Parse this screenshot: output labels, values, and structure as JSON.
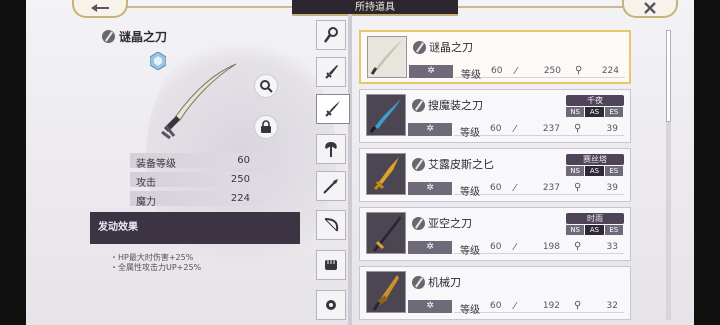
{
  "header": {
    "title": "所持道具",
    "back_icon": "back-arrow-icon",
    "close_icon": "close-x-icon"
  },
  "detail": {
    "name": "谜晶之刀",
    "stats": [
      {
        "label": "装备等级",
        "value": "60"
      },
      {
        "label": "攻击",
        "value": "250"
      },
      {
        "label": "魔力",
        "value": "224"
      }
    ],
    "effect_header": "发动效果",
    "effects": [
      "・HP最大时伤害+25%",
      "・全属性攻击力UP+25%"
    ]
  },
  "tabs": [
    {
      "icon": "staff-icon"
    },
    {
      "icon": "dagger-icon"
    },
    {
      "icon": "sword-icon",
      "active": true
    },
    {
      "icon": "axe-icon"
    },
    {
      "icon": "spear-icon"
    },
    {
      "icon": "bow-icon"
    },
    {
      "icon": "fist-icon"
    },
    {
      "icon": "gear-weapon-icon"
    }
  ],
  "items": [
    {
      "name": "谜晶之刀",
      "level_label": "等级",
      "level": "60",
      "attack": "250",
      "magic": "224",
      "owner": "",
      "selected": true
    },
    {
      "name": "搜魔装之刀",
      "level_label": "等级",
      "level": "60",
      "attack": "237",
      "magic": "39",
      "owner": "千夜",
      "tags": [
        "NS",
        "AS",
        "ES"
      ]
    },
    {
      "name": "艾露皮斯之匕",
      "level_label": "等级",
      "level": "60",
      "attack": "237",
      "magic": "39",
      "owner": "赛丝塔",
      "tags": [
        "NS",
        "AS",
        "ES"
      ]
    },
    {
      "name": "亚空之刀",
      "level_label": "等级",
      "level": "60",
      "attack": "198",
      "magic": "33",
      "owner": "时雨",
      "tags": [
        "NS",
        "AS",
        "ES"
      ]
    },
    {
      "name": "机械刀",
      "level_label": "等级",
      "level": "60",
      "attack": "192",
      "magic": "32",
      "owner": ""
    }
  ],
  "colors": {
    "accent_gold": "#e6c86a",
    "panel_dark": "#3c3443",
    "element_bar": "#6f6a7a"
  }
}
